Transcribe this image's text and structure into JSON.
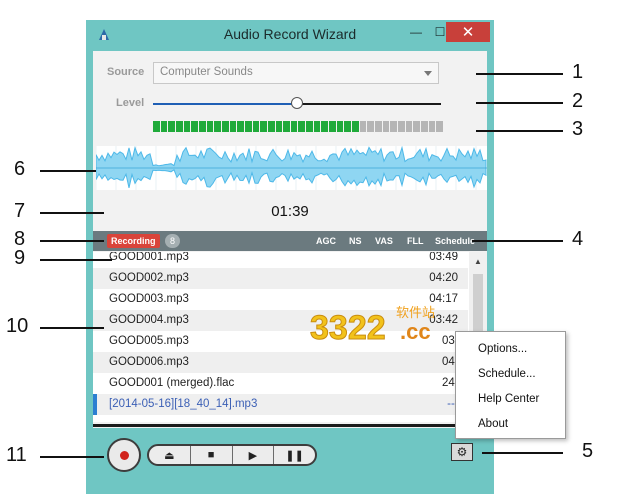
{
  "window": {
    "title": "Audio Record Wizard"
  },
  "source": {
    "label": "Source",
    "value": "Computer Sounds"
  },
  "level": {
    "label": "Level",
    "value_fraction": 0.5
  },
  "meter": {
    "green_segments": 27,
    "total_segments": 38
  },
  "timer": "01:39",
  "status": {
    "recording": "Recording",
    "count": "8",
    "flags": [
      "AGC",
      "NS",
      "VAS",
      "FLL",
      "Schedule"
    ]
  },
  "files": [
    {
      "name": "GOOD001.mp3",
      "duration": "03:49"
    },
    {
      "name": "GOOD002.mp3",
      "duration": "04:20"
    },
    {
      "name": "GOOD003.mp3",
      "duration": "04:17"
    },
    {
      "name": "GOOD004.mp3",
      "duration": "03:42"
    },
    {
      "name": "GOOD005.mp3",
      "duration": "03:"
    },
    {
      "name": "GOOD006.mp3",
      "duration": "04:"
    },
    {
      "name": "GOOD001 (merged).flac",
      "duration": "24:"
    },
    {
      "name": "[2014-05-16][18_40_14].mp3",
      "duration": "--:"
    }
  ],
  "controls": {
    "eject": "⏏",
    "stop": "■",
    "play": "▶",
    "pause": "❚❚"
  },
  "menu": {
    "items": [
      "Options...",
      "Schedule...",
      "Help Center",
      "About"
    ]
  },
  "callouts": [
    "1",
    "2",
    "3",
    "4",
    "5",
    "6",
    "7",
    "8",
    "9",
    "10",
    "11"
  ],
  "watermark": {
    "text1": "3322",
    "text2": "软件站",
    "text3": ".cc"
  },
  "colors": {
    "accent": "#6fc6c3",
    "recording": "#d9443a",
    "meter_on": "#1faa3a",
    "wave": "#4db8e8",
    "selected_text": "#3b5fb5"
  }
}
